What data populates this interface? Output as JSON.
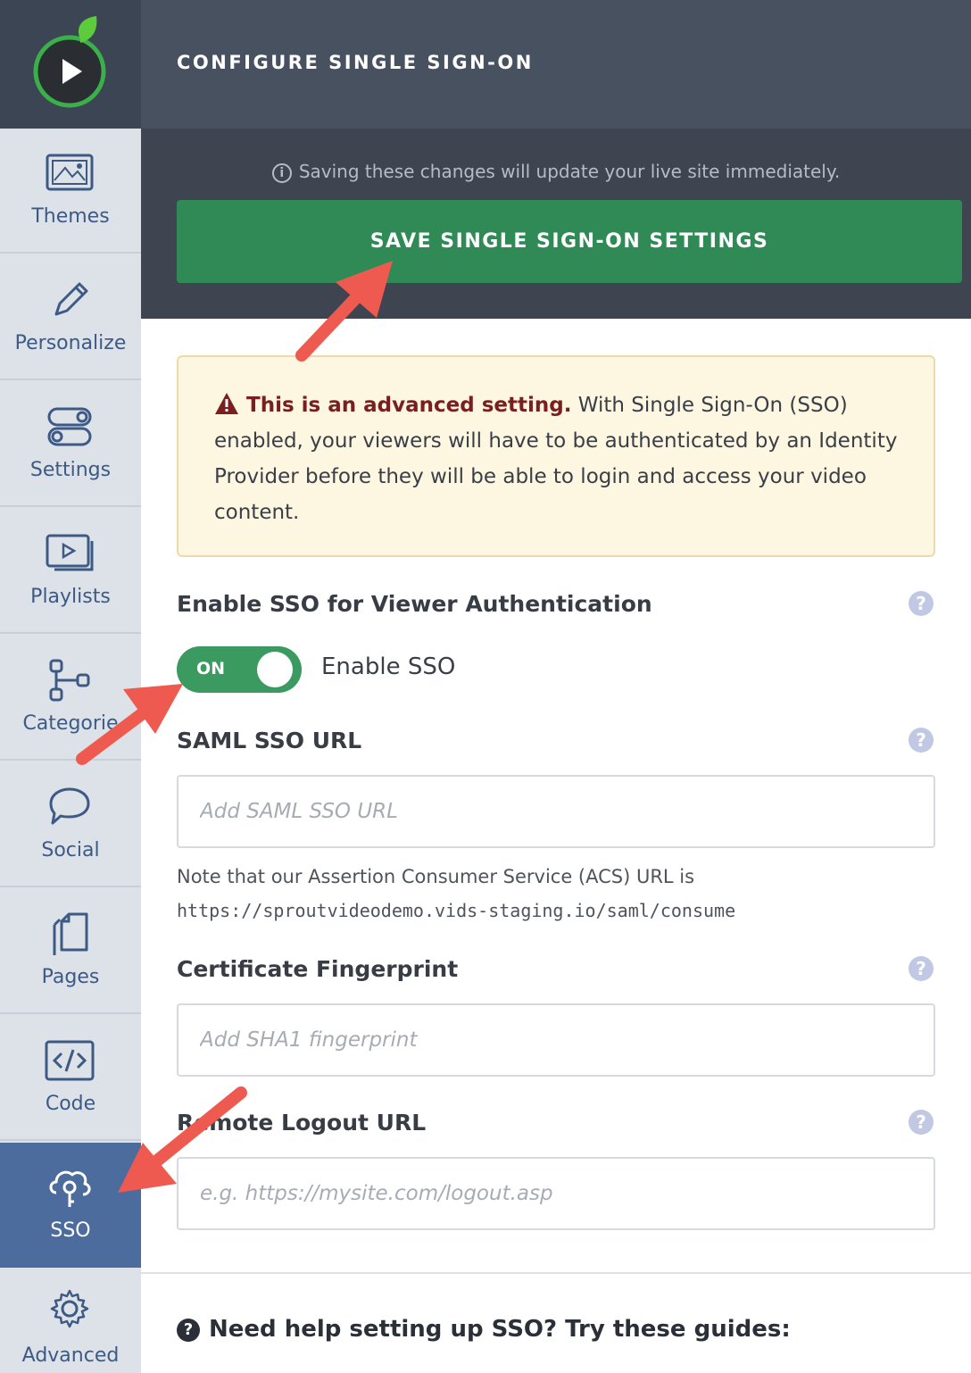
{
  "header": {
    "title": "CONFIGURE SINGLE SIGN-ON"
  },
  "sidebar": {
    "items": [
      {
        "label": "Themes",
        "icon": "image-icon"
      },
      {
        "label": "Personalize",
        "icon": "pencil-icon"
      },
      {
        "label": "Settings",
        "icon": "toggles-icon"
      },
      {
        "label": "Playlists",
        "icon": "playlist-icon"
      },
      {
        "label": "Categorie",
        "icon": "hierarchy-icon"
      },
      {
        "label": "Social",
        "icon": "chat-bubble-icon"
      },
      {
        "label": "Pages",
        "icon": "pages-icon"
      },
      {
        "label": "Code",
        "icon": "code-icon"
      },
      {
        "label": "SSO",
        "icon": "lock-cloud-icon",
        "active": true
      },
      {
        "label": "Advanced",
        "icon": "gear-icon"
      }
    ]
  },
  "save": {
    "note": "Saving these changes will update your live site immediately.",
    "button_label": "SAVE SINGLE SIGN-ON SETTINGS"
  },
  "warning": {
    "strong": "This is an advanced setting.",
    "text": "With Single Sign-On (SSO) enabled, your viewers will have to be authenticated by an Identity Provider before they will be able to login and access your video content."
  },
  "enable_sso": {
    "label": "Enable SSO for Viewer Authentication",
    "toggle_state": "ON",
    "toggle_label": "Enable SSO"
  },
  "saml": {
    "label": "SAML SSO URL",
    "placeholder": "Add SAML SSO URL",
    "note": "Note that our Assertion Consumer Service (ACS) URL is",
    "acs_url": "https://sproutvideodemo.vids-staging.io/saml/consume"
  },
  "certificate": {
    "label": "Certificate Fingerprint",
    "placeholder": "Add SHA1 fingerprint"
  },
  "logout": {
    "label": "Remote Logout URL",
    "placeholder": "e.g. https://mysite.com/logout.asp"
  },
  "help": {
    "text": "Need help setting up SSO? Try these guides:"
  },
  "colors": {
    "brand_green": "#2f8a56",
    "toggle_green": "#3a9a60",
    "sidebar_active": "#4d6c9e",
    "annotation_arrow": "#ee5a4f"
  }
}
